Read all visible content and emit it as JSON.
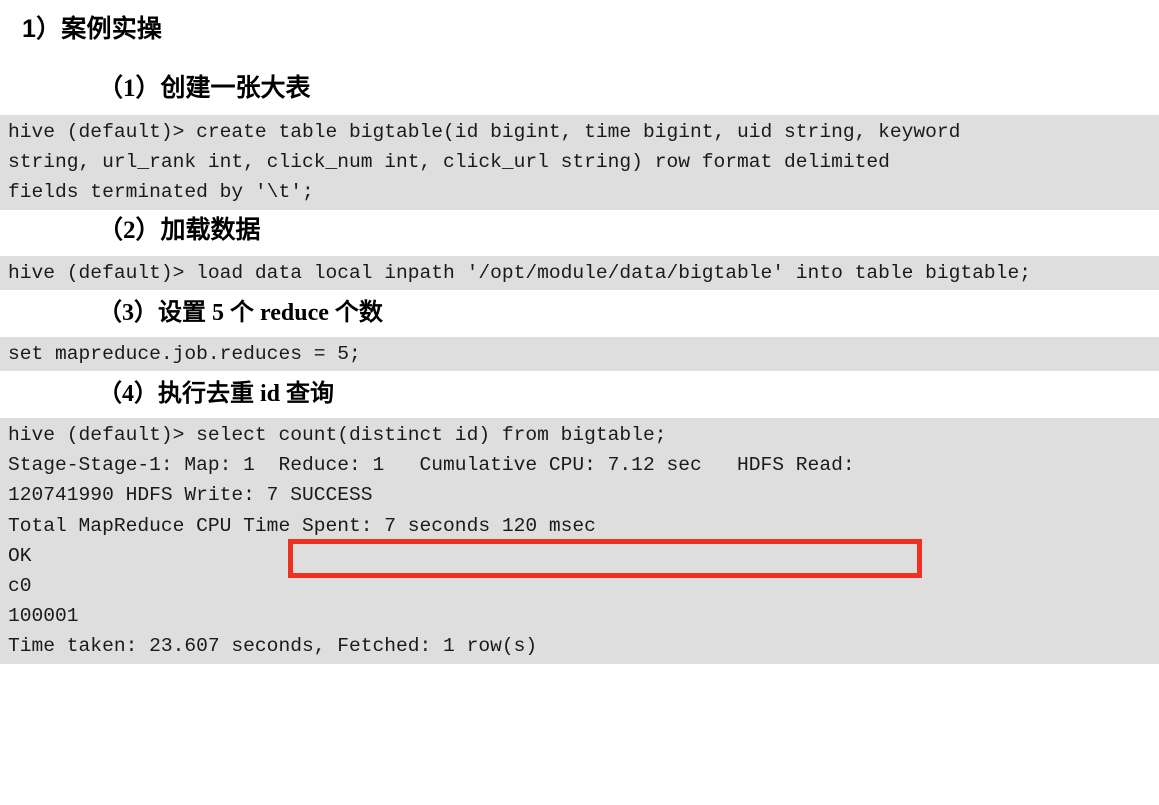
{
  "document": {
    "section_heading": "1）案例实操",
    "subsections": [
      {
        "heading": "（1）创建一张大表",
        "code_lines": [
          "hive (default)> create table bigtable(id bigint, time bigint, uid string, keyword",
          "string, url_rank int, click_num int, click_url string) row format delimited",
          "fields terminated by '\\t';"
        ]
      },
      {
        "heading": "（2）加载数据",
        "code_lines": [
          "hive (default)> load data local inpath '/opt/module/data/bigtable' into table bigtable;"
        ]
      },
      {
        "heading": "（3）设置 5 个 reduce 个数",
        "code_lines": [
          "set mapreduce.job.reduces = 5;"
        ]
      },
      {
        "heading": "（4）执行去重 id 查询",
        "code_lines": [
          "hive (default)> select count(distinct id) from bigtable;",
          "Stage-Stage-1: Map: 1  Reduce: 1   Cumulative CPU: 7.12 sec   HDFS Read:",
          "120741990 HDFS Write: 7 SUCCESS",
          "Total MapReduce CPU Time Spent: 7 seconds 120 msec",
          "OK",
          "c0",
          "100001",
          "Time taken: 23.607 seconds, Fetched: 1 row(s)"
        ]
      }
    ]
  },
  "annotation": {
    "highlight_label": "select count(distinct id) from bigtable;",
    "highlight_color": "#ef3124"
  },
  "colors": {
    "code_background": "#dedede",
    "code_text": "#1a1a1a",
    "page_background": "#ffffff",
    "annotation_red": "#ef3124"
  }
}
